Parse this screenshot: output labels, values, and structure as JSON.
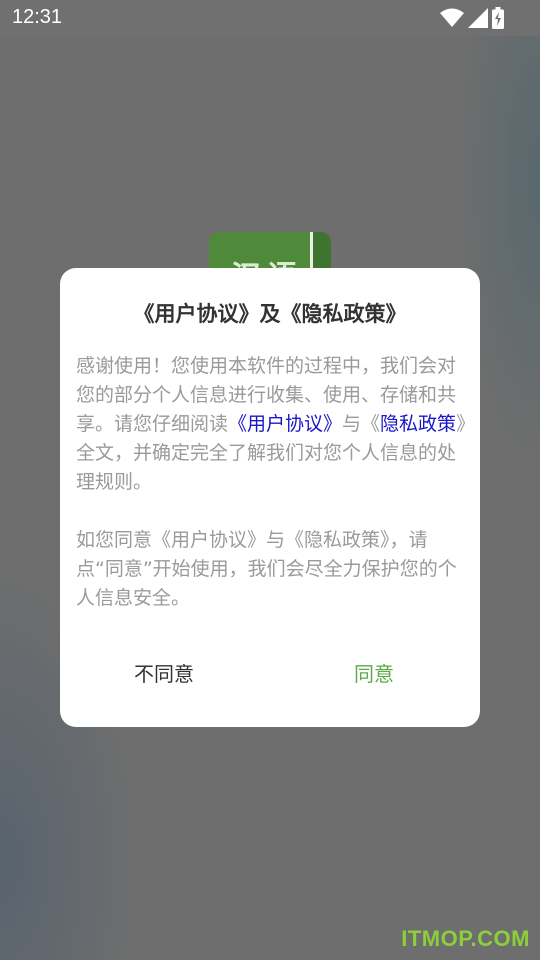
{
  "status_bar": {
    "time": "12:31",
    "icons": [
      "wifi-icon",
      "signal-icon",
      "battery-icon"
    ]
  },
  "app_logo": {
    "text": "汉语"
  },
  "dialog": {
    "title": "《用户协议》及《隐私政策》",
    "paragraph1": {
      "part1": "感谢使用！您使用本软件的过程中，我们会对您的部分个人信息进行收集、使用、存储和共享。请您仔细阅读",
      "link_user_agreement": "《用户协议》",
      "part2": "与《",
      "link_privacy_policy": "隐私政策",
      "part3": "》全文，并确定完全了解我们对您个人信息的处理规则。"
    },
    "paragraph2": "如您同意《用户协议》与《隐私政策》，请点“同意”开始使用，我们会尽全力保护您的个人信息安全。",
    "disagree_label": "不同意",
    "agree_label": "同意"
  },
  "watermark": "ITMOP.COM",
  "colors": {
    "accent_green": "#5bab46",
    "link_blue": "#1a16c8",
    "overlay_gray": "#6e6e6e"
  }
}
